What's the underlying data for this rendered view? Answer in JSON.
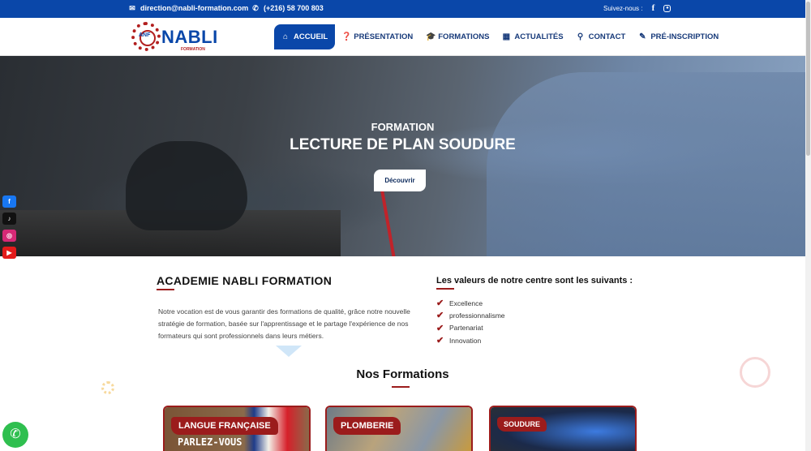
{
  "topbar": {
    "email": "direction@nabli-formation.com",
    "phone": "(+216) 58 700 803",
    "follow_label": "Suivez-nous :",
    "icons": [
      "mail-icon",
      "phone-icon",
      "facebook-icon",
      "instagram-icon"
    ]
  },
  "logo": {
    "name": "NABLI",
    "sub": "FORMATION",
    "mark": "ANF"
  },
  "nav": {
    "items": [
      {
        "label": "ACCUEIL",
        "icon": "home-icon"
      },
      {
        "label": "PRÉSENTATION",
        "icon": "question-icon"
      },
      {
        "label": "FORMATIONS",
        "icon": "graduation-cap-icon"
      },
      {
        "label": "ACTUALITÉS",
        "icon": "calendar-icon"
      },
      {
        "label": "CONTACT",
        "icon": "map-pin-icon"
      },
      {
        "label": "PRÉ-INSCRIPTION",
        "icon": "edit-icon"
      }
    ]
  },
  "hero": {
    "subtitle": "FORMATION",
    "title": "LECTURE DE PLAN SOUDURE",
    "button": "Découvrir"
  },
  "side_social": [
    "facebook",
    "tiktok",
    "instagram",
    "youtube"
  ],
  "about": {
    "title": "ACADEMIE NABLI FORMATION",
    "text": "Notre vocation est de vous garantir des formations de qualité, grâce notre nouvelle stratégie de formation, basée sur l'apprentissage et le partage l'expérience de nos formateurs qui sont professionnels dans leurs métiers."
  },
  "values": {
    "title": "Les valeurs de notre centre sont les suivants :",
    "items": [
      "Excellence",
      "professionnalisme",
      "Partenariat",
      "Innovation"
    ]
  },
  "formations": {
    "title": "Nos Formations",
    "cards": [
      "LANGUE FRANÇAISE",
      "PLOMBERIE",
      "SOUDURE"
    ],
    "card_image_text": "PARLEZ-VOUS"
  },
  "colors": {
    "primary": "#0a47a9",
    "accent": "#9b1c1c",
    "whatsapp": "#2fbf4f"
  }
}
